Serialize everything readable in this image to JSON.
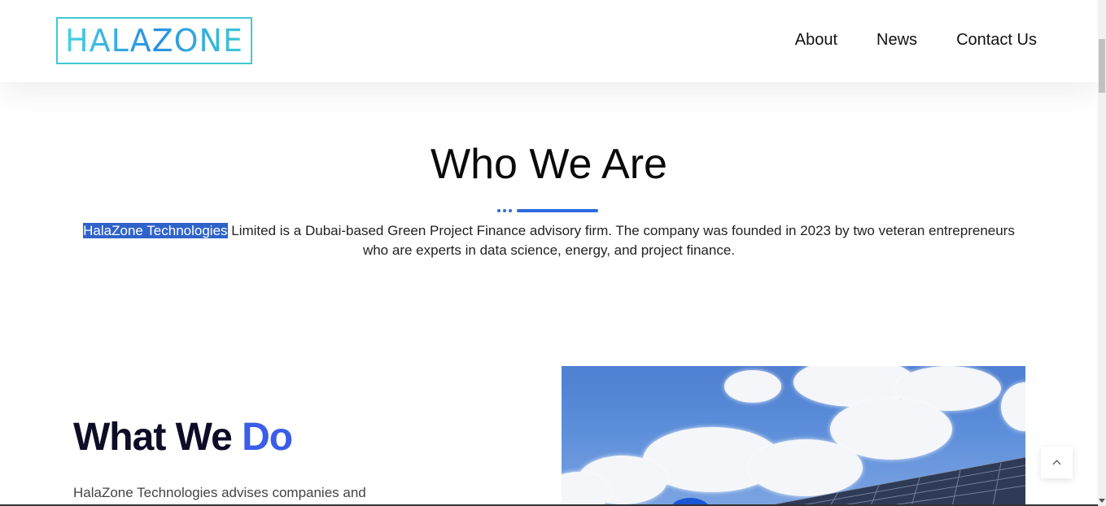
{
  "header": {
    "logo_text": "HALAZONE",
    "nav": [
      "About",
      "News",
      "Contact Us"
    ]
  },
  "who": {
    "title": "Who We Are",
    "highlight": "HalaZone Technologies",
    "paragraph_rest": " Limited is a Dubai-based Green Project Finance advisory firm. The company was founded in 2023 by two veteran entrepreneurs who are experts in data science, energy, and project finance."
  },
  "what": {
    "title_main": "What We ",
    "title_accent": "Do",
    "paragraph": "HalaZone Technologies advises companies and"
  },
  "colors": {
    "accent": "#3b5de7",
    "divider": "#2d6bdf",
    "highlight_bg": "#2f63c9",
    "logo_border": "#3fc9d4"
  },
  "icons": {
    "scroll_top": "chevron-up-icon"
  }
}
